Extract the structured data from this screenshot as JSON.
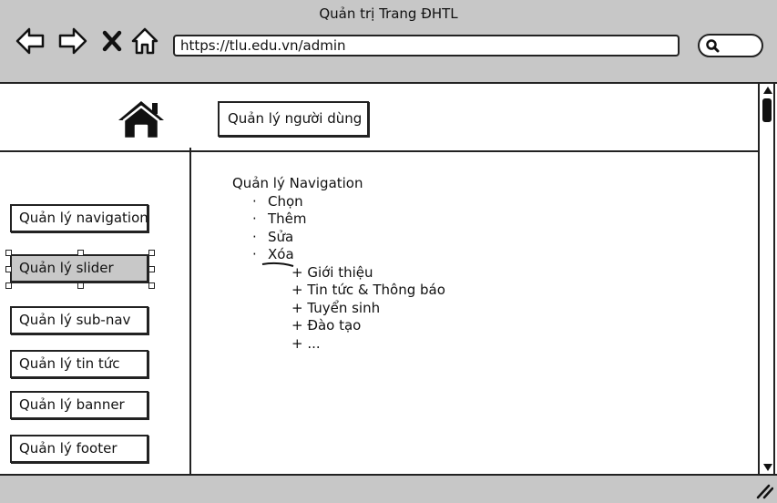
{
  "window": {
    "title": "Quản trị Trang ĐHTL"
  },
  "browser": {
    "back_icon": "arrow-left-icon",
    "forward_icon": "arrow-right-icon",
    "stop_icon": "close-icon",
    "home_icon": "home-icon",
    "url": "https://tlu.edu.vn/admin",
    "search_icon": "search-icon"
  },
  "header": {
    "logo_icon": "home-icon",
    "user_management_button": "Quản lý người dùng"
  },
  "sidebar": {
    "items": [
      {
        "label": "Quản lý navigation",
        "selected": false
      },
      {
        "label": "Quản lý slider",
        "selected": true
      },
      {
        "label": "Quản lý sub-nav",
        "selected": false
      },
      {
        "label": "Quản lý tin tức",
        "selected": false
      },
      {
        "label": "Quản lý banner",
        "selected": false
      },
      {
        "label": "Quản lý footer",
        "selected": false
      }
    ]
  },
  "main": {
    "title": "Quản lý Navigation",
    "bullet_glyph": "·",
    "bullets": [
      "Chọn",
      "Thêm",
      "Sửa",
      "Xóa"
    ],
    "sub_items": [
      "+ Giới thiệu",
      "+ Tin tức & Thông báo",
      "+ Tuyển sinh",
      "+ Đào tạo",
      "+ ..."
    ]
  },
  "colors": {
    "chrome": "#c7c7c7",
    "selected": "#c8c8c8",
    "ink": "#222222"
  }
}
